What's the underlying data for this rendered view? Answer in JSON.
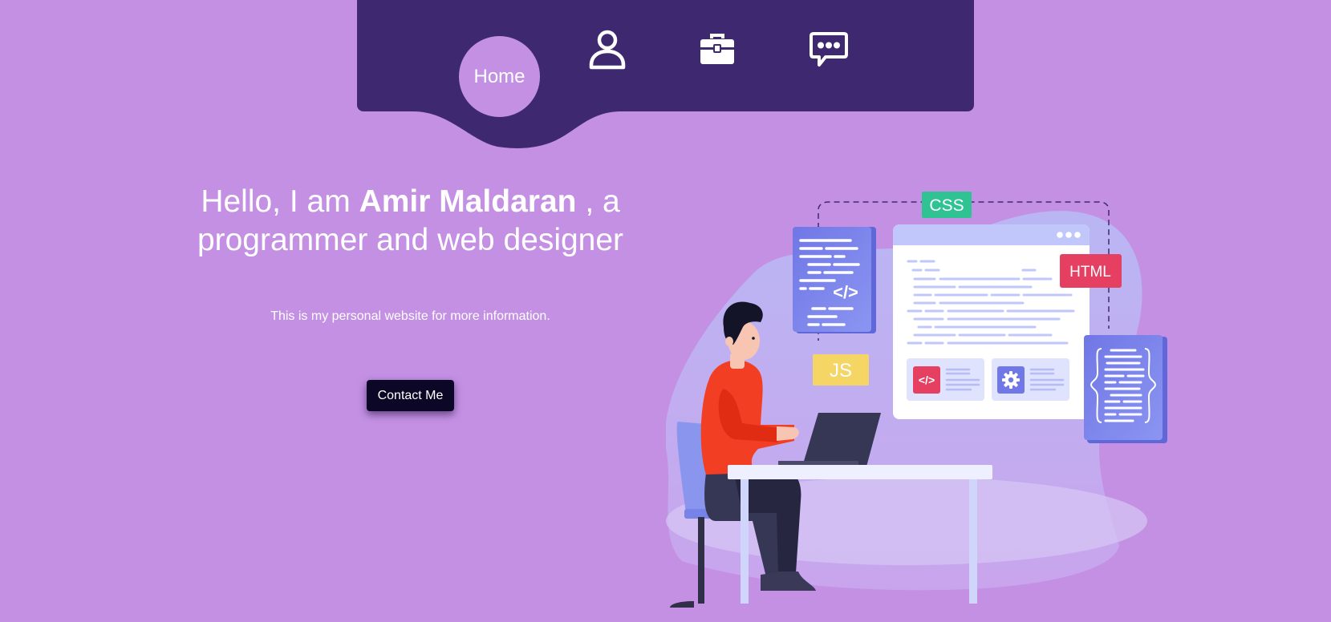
{
  "nav": {
    "home_label": "Home",
    "items": [
      {
        "name": "profile",
        "icon": "user-icon"
      },
      {
        "name": "portfolio",
        "icon": "briefcase-icon"
      },
      {
        "name": "contact",
        "icon": "chat-icon"
      }
    ],
    "bar_color": "#3e2971",
    "active_color": "#c490e4"
  },
  "hero": {
    "greeting": "Hello, I am",
    "name": "Amir Maldaran",
    "role_prefix": ", a",
    "role": "programmer and web designer",
    "subtitle": "This is my personal website for more information.",
    "contact_button": "Contact Me"
  },
  "illustration": {
    "badges": {
      "css": "CSS",
      "html": "HTML",
      "js": "JS",
      "code_tag": "</>"
    },
    "colors": {
      "css": "#2fc394",
      "html": "#e53f62",
      "js": "#f5d563",
      "card": "#7d86ea",
      "shirt": "#f23f24"
    }
  },
  "colors": {
    "background": "#c490e4",
    "button": "#0c0726",
    "text": "#ffffff"
  }
}
